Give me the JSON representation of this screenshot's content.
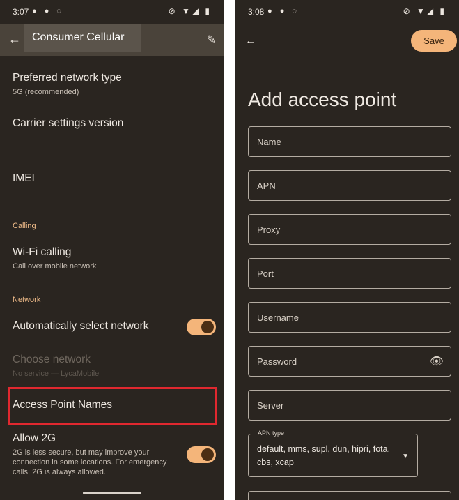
{
  "left": {
    "status_time": "3:07",
    "title": "Consumer Cellular",
    "items": {
      "preferred": {
        "title": "Preferred network type",
        "subtitle": "5G (recommended)"
      },
      "carrier": {
        "title": "Carrier settings version"
      },
      "imei": {
        "title": "IMEI"
      },
      "wifi": {
        "title": "Wi-Fi calling",
        "subtitle": "Call over mobile network"
      },
      "auto": {
        "title": "Automatically select network",
        "on": true
      },
      "choose": {
        "title": "Choose network",
        "subtitle": "No service — LycaMobile"
      },
      "apn": {
        "title": "Access Point Names"
      },
      "allow2g": {
        "title": "Allow 2G",
        "subtitle": "2G is less secure, but may improve your connection in some locations. For emergency calls, 2G is always allowed.",
        "on": true
      }
    },
    "sections": {
      "calling": "Calling",
      "network": "Network"
    }
  },
  "right": {
    "status_time": "3:08",
    "save_label": "Save",
    "heading": "Add access point",
    "fields": {
      "name": "Name",
      "apn": "APN",
      "proxy": "Proxy",
      "port": "Port",
      "username": "Username",
      "password": "Password",
      "server": "Server"
    },
    "apn_type": {
      "label": "APN type",
      "value": "default, mms, supl, dun, hipri, fota, cbs, xcap"
    }
  },
  "colors": {
    "accent": "#f4b57a",
    "background": "#2a2520",
    "highlight": "#e0282f"
  },
  "icons": [
    "back-arrow-icon",
    "pencil-icon",
    "eye-icon",
    "chevron-down-icon"
  ]
}
